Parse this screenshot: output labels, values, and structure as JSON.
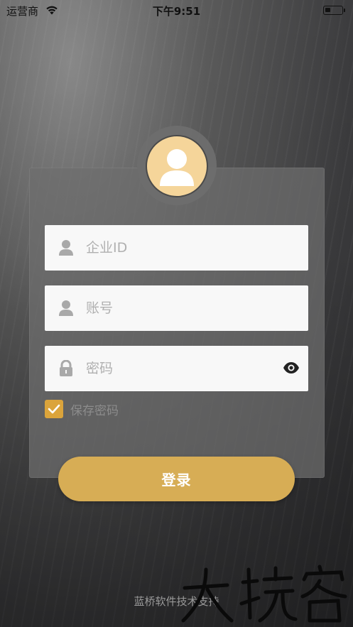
{
  "status_bar": {
    "carrier": "运营商",
    "time": "下午9:51",
    "wifi_icon": "wifi-icon",
    "battery_icon": "battery-icon",
    "battery_level": 0.35
  },
  "avatar": {
    "icon": "user-avatar-icon"
  },
  "form": {
    "company_id_placeholder": "企业ID",
    "account_placeholder": "账号",
    "password_placeholder": "密码",
    "company_id_value": "",
    "account_value": "",
    "password_value": "",
    "remember_label": "保存密码",
    "remember_checked": true,
    "login_label": "登录"
  },
  "footer": {
    "support_text": "蓝桥软件技术支持"
  },
  "colors": {
    "accent": "#d7ad55",
    "checkbox": "#dba43b",
    "avatar_bg": "#f5d59a",
    "field_bg": "#f8f8f8"
  }
}
